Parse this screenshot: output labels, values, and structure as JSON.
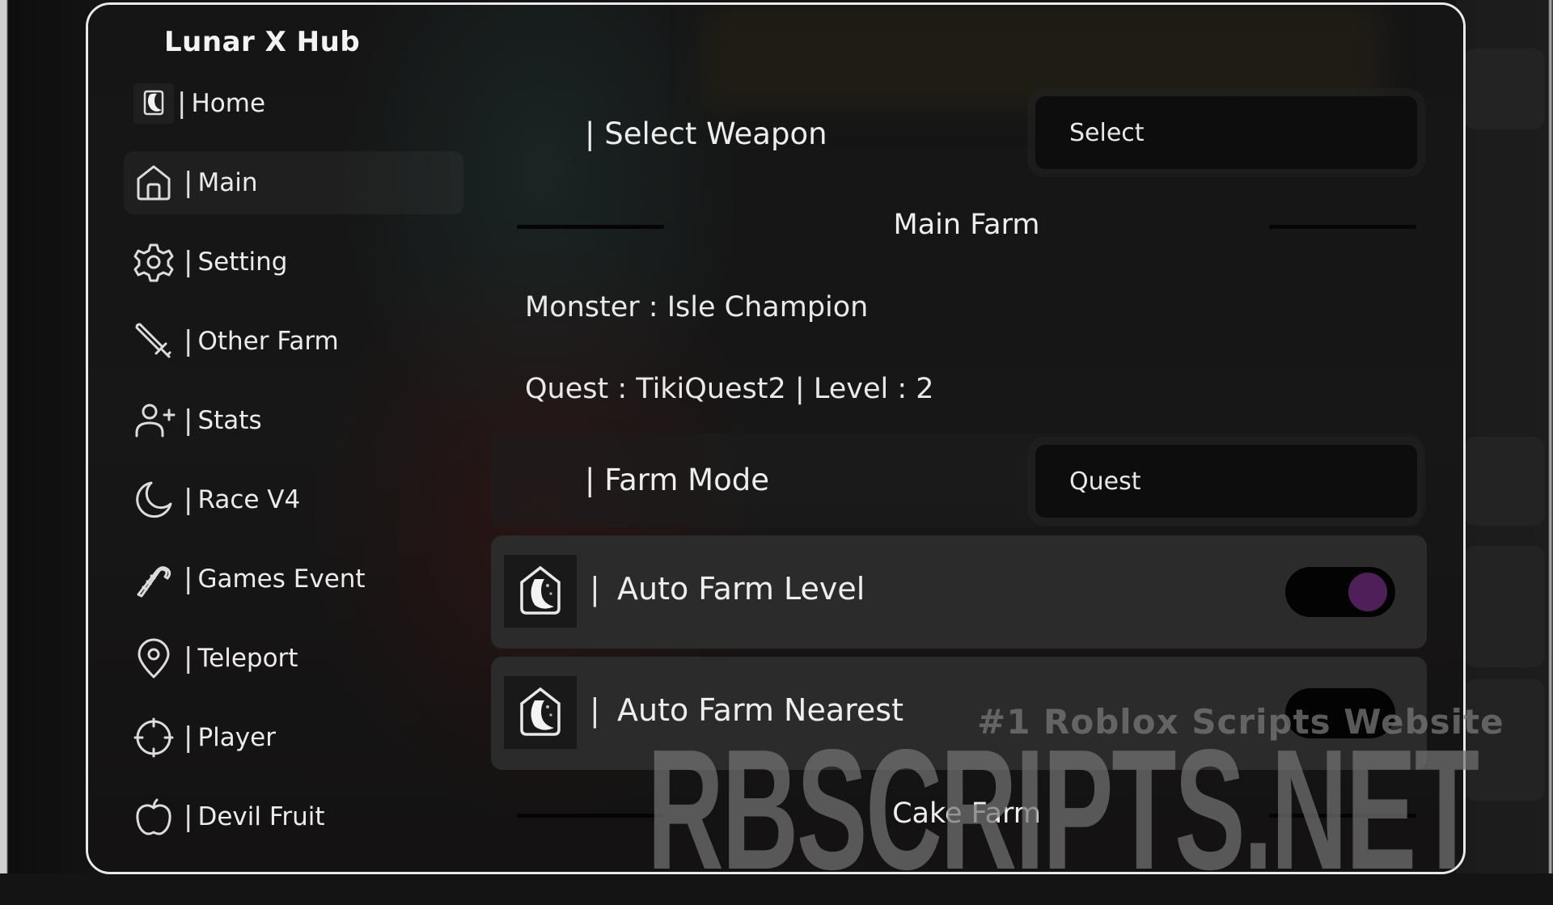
{
  "app": {
    "title": "Lunar X Hub"
  },
  "sidebar": {
    "items": [
      {
        "icon": "lunar-logo-icon",
        "label": "Home",
        "active": false
      },
      {
        "icon": "house-icon",
        "label": "Main",
        "active": true
      },
      {
        "icon": "gear-icon",
        "label": "Setting",
        "active": false
      },
      {
        "icon": "sword-icon",
        "label": "Other Farm",
        "active": false
      },
      {
        "icon": "user-plus-icon",
        "label": "Stats",
        "active": false
      },
      {
        "icon": "moon-icon",
        "label": "Race V4",
        "active": false
      },
      {
        "icon": "candy-cane-icon",
        "label": "Games Event",
        "active": false
      },
      {
        "icon": "map-pin-icon",
        "label": "Teleport",
        "active": false
      },
      {
        "icon": "crosshair-icon",
        "label": "Player",
        "active": false
      },
      {
        "icon": "apple-icon",
        "label": "Devil Fruit",
        "active": false
      }
    ],
    "separator": "|"
  },
  "main": {
    "select_weapon": {
      "label": "| Select Weapon",
      "value": "Select"
    },
    "main_farm_section": "Main Farm",
    "monster_text": "Monster : Isle Champion",
    "quest_text": "Quest : TikiQuest2 | Level : 2",
    "farm_mode": {
      "label": "| Farm Mode",
      "value": "Quest"
    },
    "toggles": [
      {
        "label": "Auto Farm Level",
        "separator": "|",
        "enabled": true
      },
      {
        "label": "Auto Farm Nearest",
        "separator": "|",
        "enabled": false
      }
    ],
    "cake_farm_section": "Cake Farm"
  },
  "watermark": {
    "tagline": "#1 Roblox Scripts Website",
    "site": "RBSCRIPTS.NET"
  },
  "colors": {
    "toggle_on_knob": "#4e1f58",
    "panel_border": "#e9e9e9",
    "card_bg": "#2b2b2b",
    "dropdown_bg": "#0d0d0d"
  }
}
